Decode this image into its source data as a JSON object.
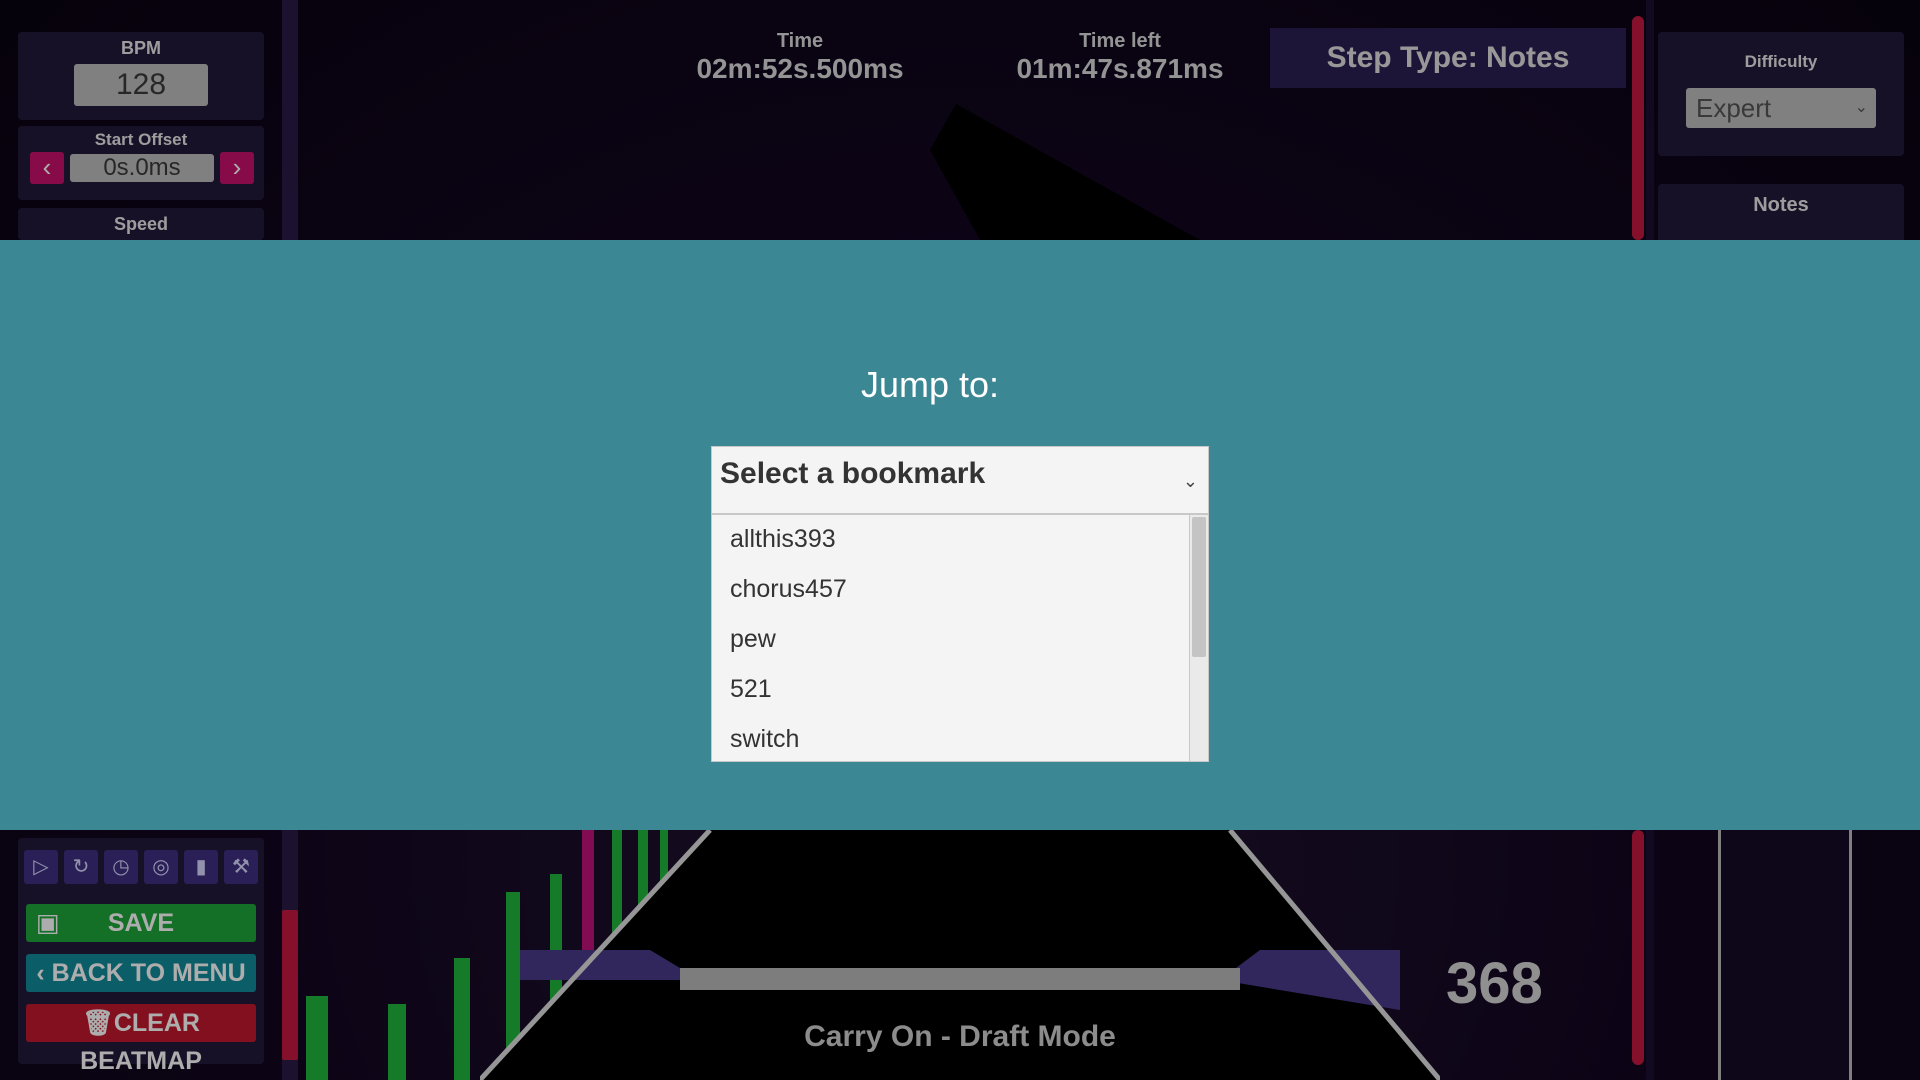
{
  "left_panel": {
    "bpm_label": "BPM",
    "bpm_value": "128",
    "start_offset_label": "Start Offset",
    "start_offset_value": "0s.0ms",
    "speed_label": "Speed"
  },
  "timing": {
    "time_label": "Time",
    "time_value": "02m:52s.500ms",
    "time_left_label": "Time left",
    "time_left_value": "01m:47s.871ms"
  },
  "step_type": "Step Type: Notes",
  "right_panel": {
    "difficulty_label": "Difficulty",
    "difficulty_value": "Expert",
    "notes_label": "Notes"
  },
  "toolbar": {
    "save_label": "SAVE",
    "back_label": "BACK TO MENU",
    "clear_label": "CLEAR BEATMAP"
  },
  "combo": "368",
  "song_title": "Carry On - Draft Mode",
  "modal": {
    "title": "Jump to:",
    "select_placeholder": "Select a bookmark",
    "options": [
      "allthis393",
      "chorus457",
      "pew",
      "521",
      "switch"
    ]
  },
  "colors": {
    "modal_band": "#3b8794",
    "accent_pink": "#c8116c",
    "save_green": "#1fa53a",
    "back_teal": "#118a99",
    "clear_red": "#c2182e"
  }
}
